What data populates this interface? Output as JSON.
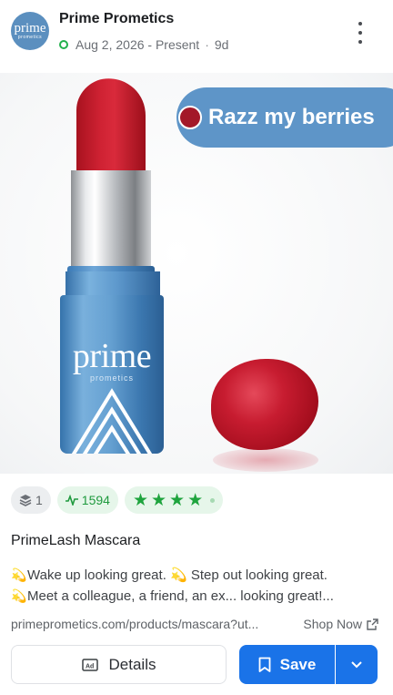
{
  "header": {
    "avatar_text": "prime",
    "avatar_subtext": "prometics",
    "brand_name": "Prime Prometics",
    "date_range": "Aug 2, 2026 - Present",
    "separator": "·",
    "age": "9d",
    "status_color": "#23b14d"
  },
  "media": {
    "tube_logo": "prime",
    "tube_subtext": "prometics",
    "shade_name": "Razz my berries",
    "shade_color": "#a31829",
    "chip_color": "#5e95c8"
  },
  "stats": {
    "layers_count": "1",
    "activity_count": "1594",
    "rating": 4,
    "rating_max": 5
  },
  "product": {
    "title": "PrimeLash Mascara",
    "description_line1": "Wake up looking great. 💫 Step out looking great.",
    "description_line2": "Meet a colleague, a friend, an ex... looking great!...",
    "emoji_icon": "dizzy-icon",
    "url": "primeprometics.com/products/mascara?ut...",
    "shop_label": "Shop Now"
  },
  "actions": {
    "details_label": "Details",
    "save_label": "Save",
    "accent": "#1a73e8"
  }
}
